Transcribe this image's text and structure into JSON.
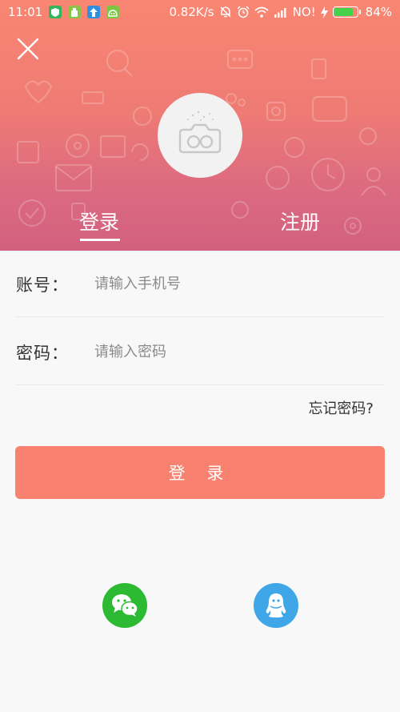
{
  "status_bar": {
    "time": "11:01",
    "network_speed": "0.82K/s",
    "carrier": "NO!",
    "battery_percent": "84%",
    "battery_level": 0.84,
    "icons": [
      "shield-app-icon",
      "android-app-icon",
      "upload-app-icon",
      "android-debug-icon",
      "mute-icon",
      "alarm-icon",
      "wifi-icon",
      "signal-icon",
      "charging-icon",
      "battery-icon"
    ]
  },
  "header": {
    "close_icon": "close-icon",
    "avatar_icon": "camera-icon"
  },
  "tabs": {
    "login": "登录",
    "register": "注册",
    "active": "login"
  },
  "form": {
    "account_label": "账号：",
    "account_placeholder": "请输入手机号",
    "account_value": "",
    "password_label": "密码：",
    "password_placeholder": "请输入密码",
    "password_value": "",
    "forgot_password": "忘记密码?",
    "login_button": "登 录"
  },
  "social_login": {
    "wechat_icon": "wechat-icon",
    "qq_icon": "qq-icon"
  },
  "colors": {
    "header_top": "#f98672",
    "header_bottom": "#d2617f",
    "login_button": "#f8826f",
    "wechat": "#2cba33",
    "qq": "#3fa7e8"
  }
}
